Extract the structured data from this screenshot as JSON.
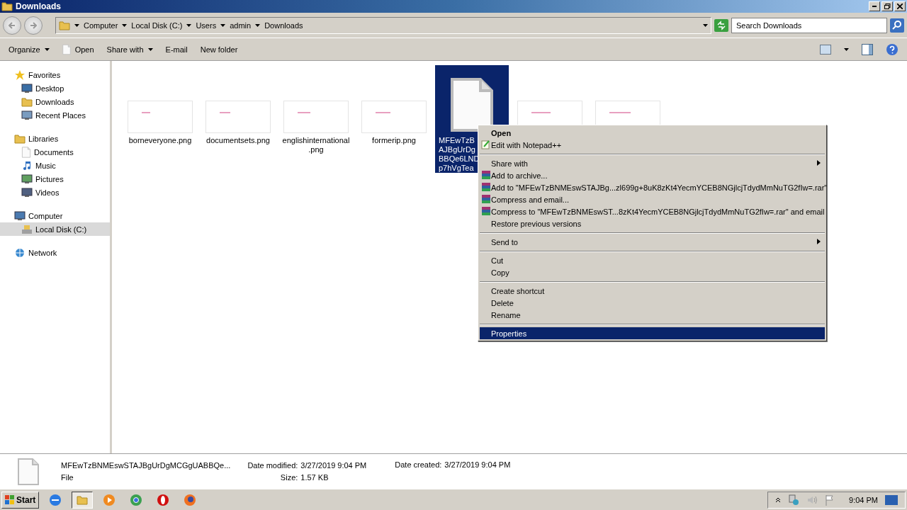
{
  "window": {
    "title": "Downloads"
  },
  "address": {
    "crumbs": [
      "Computer",
      "Local Disk (C:)",
      "Users",
      "admin",
      "Downloads"
    ],
    "search_placeholder": "Search Downloads"
  },
  "toolbar": [
    {
      "label": "Organize",
      "kind": "menu"
    },
    {
      "label": "Open",
      "kind": "open"
    },
    {
      "label": "Share with",
      "kind": "menu"
    },
    {
      "label": "E-mail",
      "kind": "plain"
    },
    {
      "label": "New folder",
      "kind": "plain"
    }
  ],
  "sidebar": [
    {
      "label": "Favorites",
      "kind": "star",
      "selected": false,
      "children": [
        {
          "label": "Desktop",
          "kind": "desktop",
          "selected": false
        },
        {
          "label": "Downloads",
          "kind": "folder",
          "selected": false
        },
        {
          "label": "Recent Places",
          "kind": "recent",
          "selected": false
        }
      ]
    },
    {
      "label": "Libraries",
      "kind": "library",
      "selected": false,
      "children": [
        {
          "label": "Documents",
          "kind": "doc",
          "selected": false
        },
        {
          "label": "Music",
          "kind": "music",
          "selected": false
        },
        {
          "label": "Pictures",
          "kind": "pictures",
          "selected": false
        },
        {
          "label": "Videos",
          "kind": "videos",
          "selected": false
        }
      ]
    },
    {
      "label": "Computer",
      "kind": "computer",
      "selected": false,
      "children": [
        {
          "label": "Local Disk (C:)",
          "kind": "disk",
          "selected": true
        }
      ]
    },
    {
      "label": "Network",
      "kind": "network",
      "selected": false
    }
  ],
  "files": [
    {
      "name_lines": [
        "borneveryone.png"
      ],
      "kind": "thumb",
      "selected": false
    },
    {
      "name_lines": [
        "documentsets.png"
      ],
      "kind": "thumb",
      "selected": false
    },
    {
      "name_lines": [
        "englishinternational",
        ".png"
      ],
      "kind": "thumb",
      "selected": false
    },
    {
      "name_lines": [
        "formerip.png"
      ],
      "kind": "thumb",
      "selected": false
    },
    {
      "name_lines": [
        "MFEwTzB",
        "AJBgUrDg",
        "BBQe6LND",
        "p7hVgTea"
      ],
      "kind": "document",
      "selected": true
    },
    {
      "kind": "thumb",
      "selected": false
    },
    {
      "kind": "thumb",
      "selected": false
    }
  ],
  "context_menu": [
    {
      "kind": "item",
      "label": "Open",
      "bold": true,
      "selected": false
    },
    {
      "kind": "notepad",
      "label": "Edit with Notepad++",
      "selected": false
    },
    {
      "kind": "separator"
    },
    {
      "kind": "item",
      "label": "Share with",
      "submenu": true,
      "selected": false
    },
    {
      "kind": "archive",
      "label": "Add to archive...",
      "selected": false
    },
    {
      "kind": "archive",
      "label": "Add to \"MFEwTzBNMEswSTAJBg...zl699g+8uK8zKt4YecmYCEB8NGjlcjTdydMmNuTG2fIw=.rar\"",
      "selected": false
    },
    {
      "kind": "archive",
      "label": "Compress and email...",
      "selected": false
    },
    {
      "kind": "archive",
      "label": "Compress to \"MFEwTzBNMEswST...8zKt4YecmYCEB8NGjlcjTdydMmNuTG2fIw=.rar\" and email",
      "selected": false
    },
    {
      "kind": "item",
      "label": "Restore previous versions",
      "selected": false
    },
    {
      "kind": "separator"
    },
    {
      "kind": "item",
      "label": "Send to",
      "submenu": true,
      "selected": false
    },
    {
      "kind": "separator"
    },
    {
      "kind": "item",
      "label": "Cut",
      "selected": false
    },
    {
      "kind": "item",
      "label": "Copy",
      "selected": false
    },
    {
      "kind": "separator"
    },
    {
      "kind": "item",
      "label": "Create shortcut",
      "selected": false
    },
    {
      "kind": "item",
      "label": "Delete",
      "selected": false
    },
    {
      "kind": "item",
      "label": "Rename",
      "selected": false
    },
    {
      "kind": "separator"
    },
    {
      "kind": "item",
      "label": "Properties",
      "selected": true
    }
  ],
  "details": {
    "name": "MFEwTzBNMEswSTAJBgUrDgMCGgUABBQe...",
    "type": "File",
    "fields": [
      {
        "label": "Date modified:",
        "value": "3/27/2019 9:04 PM"
      },
      {
        "label": "Size:",
        "value": "1.57 KB"
      },
      {
        "label": "Date created:",
        "value": "3/27/2019 9:04 PM"
      }
    ]
  },
  "taskbar": {
    "start": "Start",
    "apps": [
      {
        "kind": "ie",
        "selected": false
      },
      {
        "kind": "explorer",
        "selected": true
      },
      {
        "kind": "media",
        "selected": false
      },
      {
        "kind": "chrome",
        "selected": false
      },
      {
        "kind": "opera",
        "selected": false
      },
      {
        "kind": "firefox",
        "selected": false
      }
    ],
    "clock": "9:04 PM"
  }
}
